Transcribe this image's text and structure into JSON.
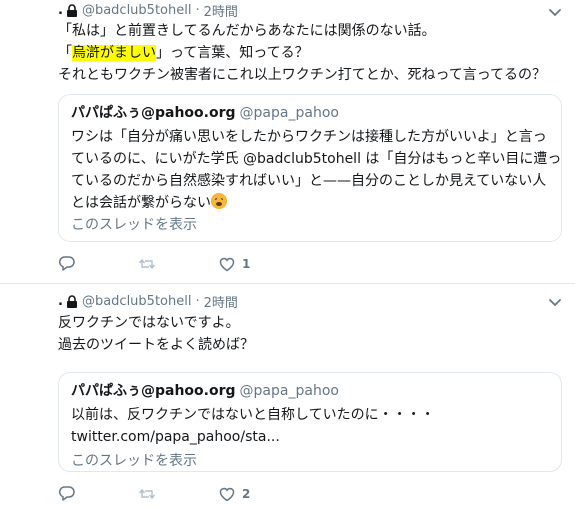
{
  "tweet1": {
    "name_prefix": ".",
    "handle": "@badclub5tohell",
    "separator": "·",
    "time": "2時間",
    "lines": [
      "「私は」と前置きしてるんだからあなたには関係のない話。",
      "「",
      "烏滸がましい",
      "」って言葉、知ってる？",
      "それともワクチン被害者にこれ以上ワクチン打てとか、死ねって言ってるの？"
    ],
    "quote": {
      "name": "パパぱふぅ@pahoo.org",
      "handle": "@papa_pahoo",
      "lines": [
        "ワシは「自分が痛い思いをしたからワクチンは接種した方がいいよ」と言っ",
        "ているのに、にいがた学氏 @badclub5tohell は「自分はもっと辛い目に遭っ",
        "ているのだから自然感染すればいい」と——自分のことしか見えていない人",
        "とは会話が繋がらない"
      ],
      "thread_link": "このスレッドを表示"
    },
    "like_count": "1"
  },
  "tweet2": {
    "name_prefix": ".",
    "handle": "@badclub5tohell",
    "separator": "·",
    "time": "2時間",
    "lines": [
      "反ワクチンではないですよ。",
      "過去のツイートをよく読めば？"
    ],
    "quote": {
      "name": "パパぱふぅ@pahoo.org",
      "handle": "@papa_pahoo",
      "lines": [
        "以前は、反ワクチンではないと自称していたのに・・・・",
        "twitter.com/papa_pahoo/sta..."
      ],
      "thread_link": "このスレッドを表示"
    },
    "like_count": "2"
  },
  "colors": {
    "text": "#14171a",
    "muted": "#657786",
    "border": "#e1e8ed",
    "highlight": "#ffff00"
  },
  "icons": [
    "lock-icon",
    "caret-down-icon",
    "reply-icon",
    "retweet-icon",
    "like-icon",
    "weary-face-emoji"
  ]
}
